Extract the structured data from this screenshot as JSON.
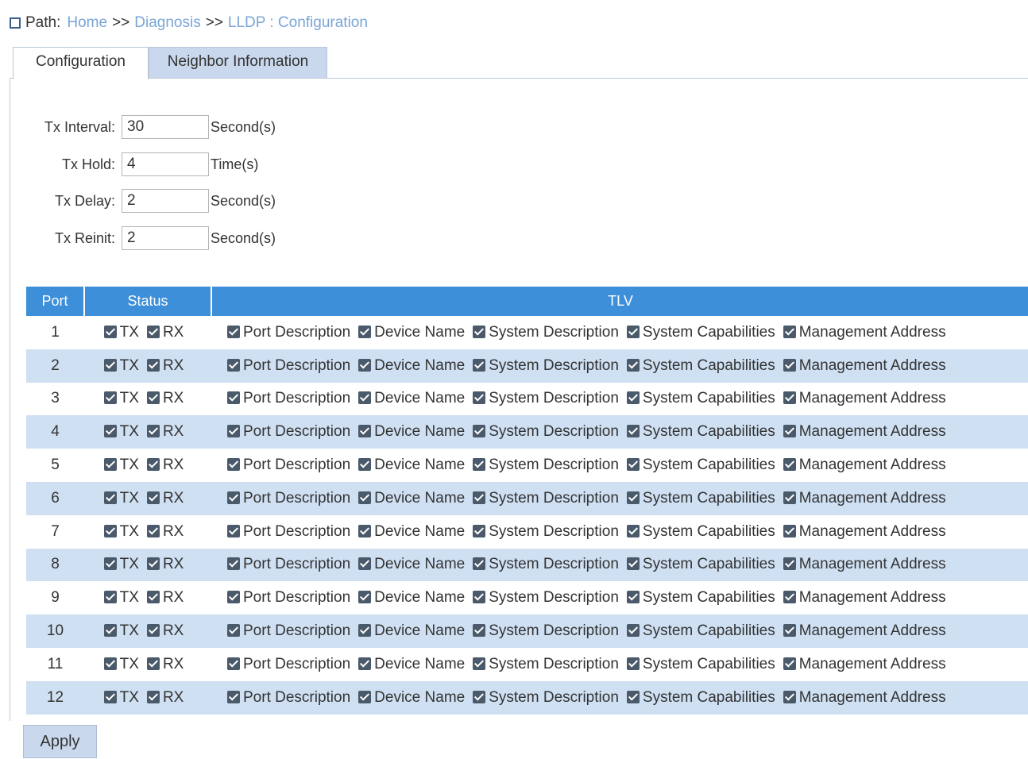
{
  "breadcrumb": {
    "prefix": "Path:",
    "items": [
      "Home",
      "Diagnosis",
      "LLDP : Configuration"
    ],
    "separator": ">>"
  },
  "tabs": [
    {
      "label": "Configuration",
      "active": true
    },
    {
      "label": "Neighbor Information",
      "active": false
    }
  ],
  "form": {
    "tx_interval": {
      "label": "Tx Interval:",
      "value": "30",
      "unit": "Second(s)"
    },
    "tx_hold": {
      "label": "Tx Hold:",
      "value": "4",
      "unit": "Time(s)"
    },
    "tx_delay": {
      "label": "Tx Delay:",
      "value": "2",
      "unit": "Second(s)"
    },
    "tx_reinit": {
      "label": "Tx Reinit:",
      "value": "2",
      "unit": "Second(s)"
    }
  },
  "table": {
    "headers": [
      "Port",
      "Status",
      "TLV"
    ],
    "status_labels": [
      "TX",
      "RX"
    ],
    "tlv_labels": [
      "Port Description",
      "Device Name",
      "System Description",
      "System Capabilities",
      "Management Address"
    ],
    "rows": [
      "1",
      "2",
      "3",
      "4",
      "5",
      "6",
      "7",
      "8",
      "9",
      "10",
      "11",
      "12"
    ]
  },
  "apply_label": "Apply",
  "colors": {
    "header_blue": "#3c8fd8",
    "stripe_blue": "#cfe0f3",
    "tab_inactive": "#c9d8ec",
    "link": "#7aa5d6"
  },
  "icons": {
    "path": "square-icon",
    "check": "checkbox-checked-icon"
  }
}
